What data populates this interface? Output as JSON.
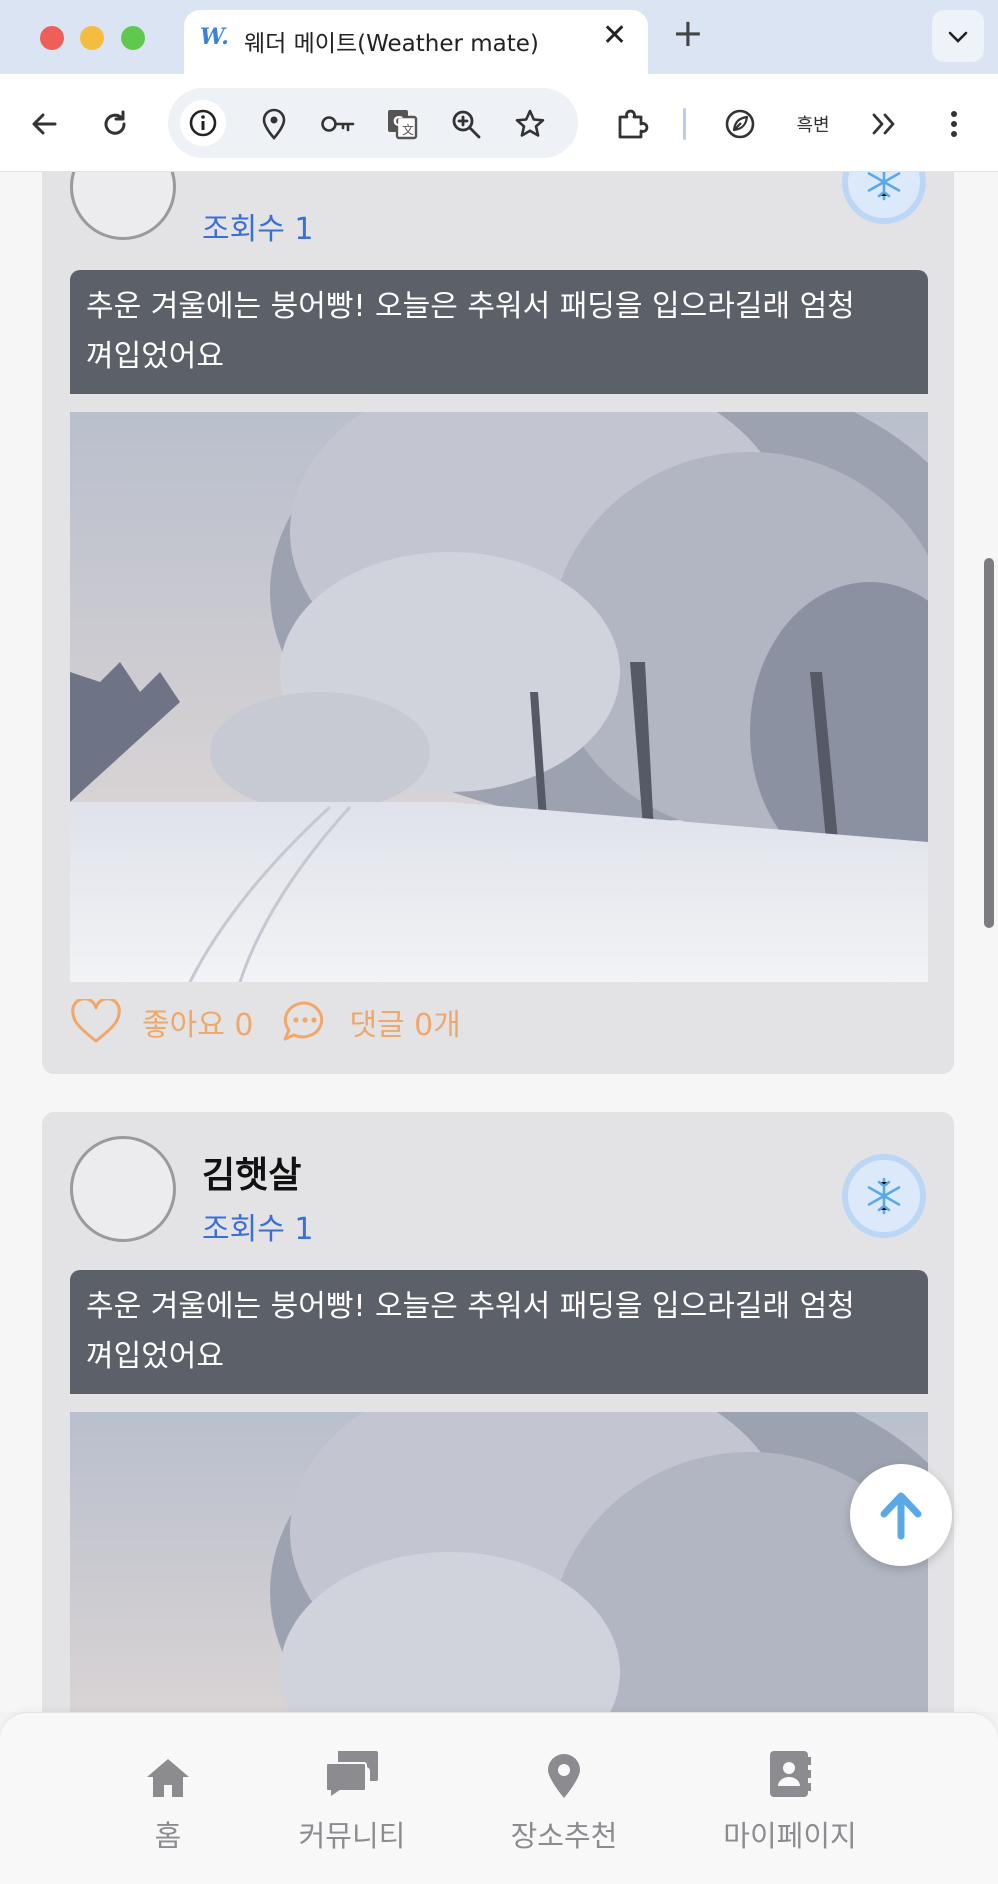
{
  "browser": {
    "tab_title": "웨더 메이트(Weather mate)",
    "favicon_text": "W.",
    "tab_close": "✕",
    "new_tab": "+",
    "tab_menu": "⌄",
    "extension_label": "흑변"
  },
  "posts": [
    {
      "author": "",
      "views": "조회수 1",
      "weather": "snow",
      "caption": "추운 겨울에는 붕어빵! 오늘은 추워서 패딩을 입으라길래 엄청 껴입었어요",
      "likes": "좋아요 0",
      "comments": "댓글 0개"
    },
    {
      "author": "김햇살",
      "views": "조회수 1",
      "weather": "snow",
      "caption": "추운 겨울에는 붕어빵! 오늘은 추워서 패딩을 입으라길래 엄청 껴입었어요"
    }
  ],
  "nav": {
    "home": "홈",
    "community": "커뮤니티",
    "places": "장소추천",
    "mypage": "마이페이지"
  },
  "colors": {
    "accent_orange": "#f0a86a",
    "views_blue": "#3a6fd8",
    "caption_bg": "#5b6069",
    "weather_badge": "#bcd6f6",
    "fab_arrow": "#5aa9e6"
  }
}
